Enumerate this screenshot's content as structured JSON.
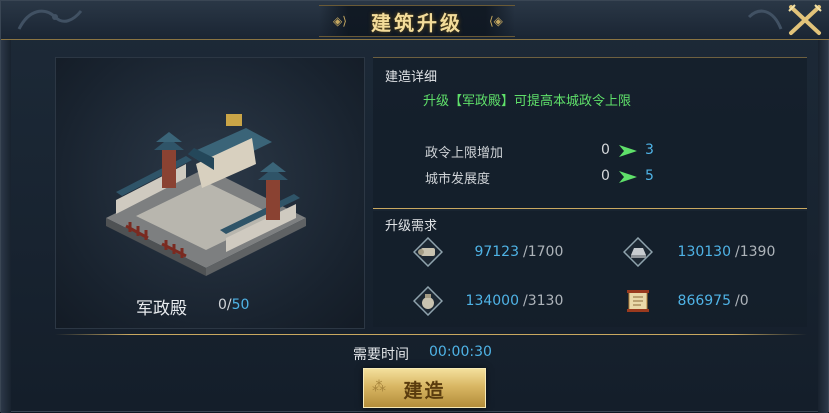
{
  "window": {
    "title": "建筑升级"
  },
  "building": {
    "name": "军政殿",
    "level_current": "0",
    "level_separator": "/",
    "level_max": "50"
  },
  "details": {
    "section_title": "建造详细",
    "description": "升级【军政殿】可提高本城政令上限",
    "stats": [
      {
        "label": "政令上限增加",
        "old": "0",
        "new": "3"
      },
      {
        "label": "城市发展度",
        "old": "0",
        "new": "5"
      }
    ]
  },
  "requirements": {
    "section_title": "升级需求",
    "items": [
      {
        "icon": "scroll-icon",
        "have": "97123",
        "need": "/1700"
      },
      {
        "icon": "silver-ingot-icon",
        "have": "130130",
        "need": "/1390"
      },
      {
        "icon": "grain-sack-icon",
        "have": "134000",
        "need": "/3130"
      },
      {
        "icon": "decree-scroll-icon",
        "have": "866975",
        "need": "/0"
      }
    ]
  },
  "time": {
    "label": "需要时间",
    "value": "00:00:30"
  },
  "actions": {
    "build_label": "建造"
  },
  "colors": {
    "accent_blue": "#4fb3e6",
    "accent_green": "#5fe06a",
    "gold": "#c9a860"
  }
}
